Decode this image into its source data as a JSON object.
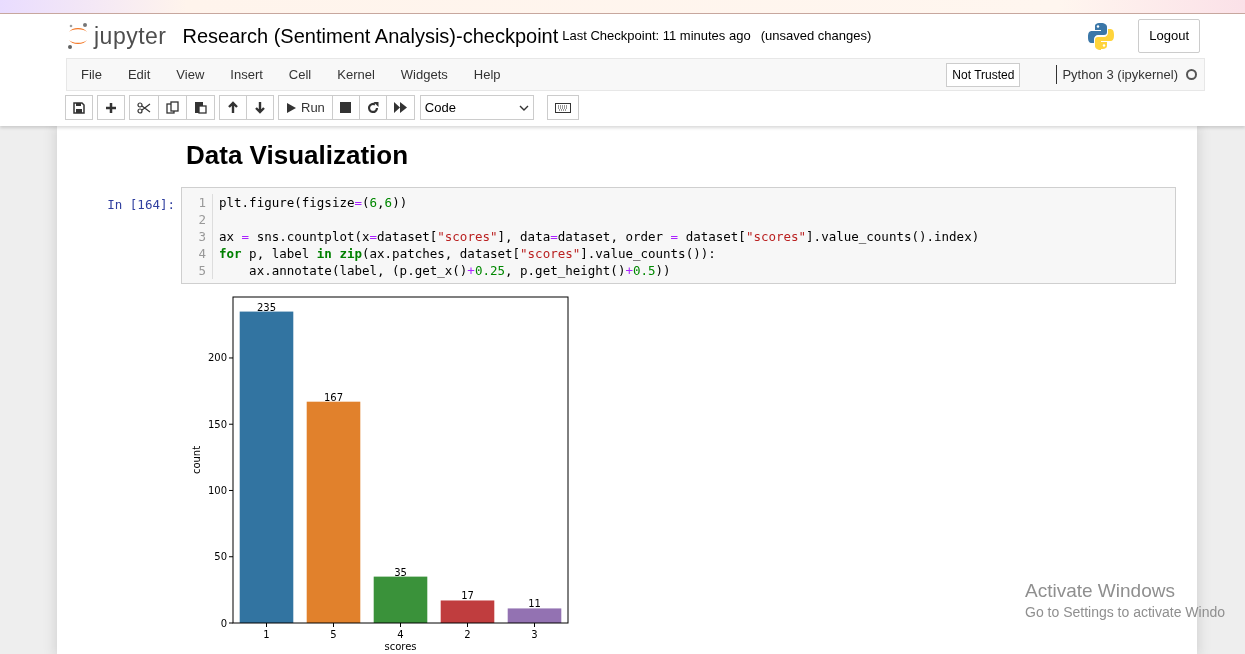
{
  "header": {
    "logo_text": "jupyter",
    "notebook_title": "Research (Sentiment Analysis)-checkpoint",
    "checkpoint": "Last Checkpoint: 11 minutes ago",
    "autosave_status": "(unsaved changes)",
    "logout": "Logout"
  },
  "menubar": {
    "items": [
      "File",
      "Edit",
      "View",
      "Insert",
      "Cell",
      "Kernel",
      "Widgets",
      "Help"
    ],
    "trust": "Not Trusted",
    "kernel_name": "Python 3 (ipykernel)",
    "kernel_busy": false
  },
  "toolbar": {
    "run": "Run",
    "cell_type": "Code"
  },
  "cells": [
    {
      "kind": "markdown",
      "heading": "Data Visualization"
    },
    {
      "kind": "code",
      "prompt": "In [164]:",
      "lines": [
        {
          "number": "1",
          "tokens": [
            {
              "text": "plt.figure(figsize",
              "kind": "plain"
            },
            {
              "text": "=",
              "kind": "op"
            },
            {
              "text": "(",
              "kind": "plain"
            },
            {
              "text": "6",
              "kind": "num"
            },
            {
              "text": ",",
              "kind": "plain"
            },
            {
              "text": "6",
              "kind": "num"
            },
            {
              "text": "))",
              "kind": "plain"
            }
          ]
        },
        {
          "number": "2"
        },
        {
          "number": "3",
          "tokens": [
            {
              "text": "ax ",
              "kind": "plain"
            },
            {
              "text": "=",
              "kind": "op"
            },
            {
              "text": " sns.countplot(x",
              "kind": "plain"
            },
            {
              "text": "=",
              "kind": "op"
            },
            {
              "text": "dataset[",
              "kind": "plain"
            },
            {
              "text": "\"scores\"",
              "kind": "str"
            },
            {
              "text": "], data",
              "kind": "plain"
            },
            {
              "text": "=",
              "kind": "op"
            },
            {
              "text": "dataset, order ",
              "kind": "plain"
            },
            {
              "text": "=",
              "kind": "op"
            },
            {
              "text": " dataset[",
              "kind": "plain"
            },
            {
              "text": "\"scores\"",
              "kind": "str"
            },
            {
              "text": "].value_counts().index)",
              "kind": "plain"
            }
          ]
        },
        {
          "number": "4",
          "tokens": [
            {
              "text": "for",
              "kind": "kw"
            },
            {
              "text": " p, label ",
              "kind": "plain"
            },
            {
              "text": "in",
              "kind": "kw"
            },
            {
              "text": " zip",
              "kind": "kw"
            },
            {
              "text": "(ax.patches, dataset[",
              "kind": "plain"
            },
            {
              "text": "\"scores\"",
              "kind": "str"
            },
            {
              "text": "].value_counts()):",
              "kind": "plain"
            }
          ]
        },
        {
          "number": "5",
          "tokens": [
            {
              "text": "    ax.annotate(label, (p.get_x()",
              "kind": "plain"
            },
            {
              "text": "+",
              "kind": "op"
            },
            {
              "text": "0.25",
              "kind": "num"
            },
            {
              "text": ", p.get_height()",
              "kind": "plain"
            },
            {
              "text": "+",
              "kind": "op"
            },
            {
              "text": "0.5",
              "kind": "num"
            },
            {
              "text": "))",
              "kind": "plain"
            }
          ]
        }
      ],
      "output": {
        "chart_data": {
          "type": "bar",
          "xlabel": "scores",
          "ylabel": "count",
          "categories": [
            "1",
            "5",
            "4",
            "2",
            "3"
          ],
          "values": [
            235,
            167,
            35,
            17,
            11
          ],
          "colors": [
            "#3274a1",
            "#e1812c",
            "#3a923a",
            "#c03d3e",
            "#9372b2"
          ],
          "ylim": [
            0,
            246
          ],
          "yticks": [
            0,
            50,
            100,
            150,
            200
          ],
          "data_labels": true
        }
      }
    }
  ],
  "os_overlay": {
    "title": "Activate Windows",
    "message": "Go to Settings to activate Windo"
  }
}
